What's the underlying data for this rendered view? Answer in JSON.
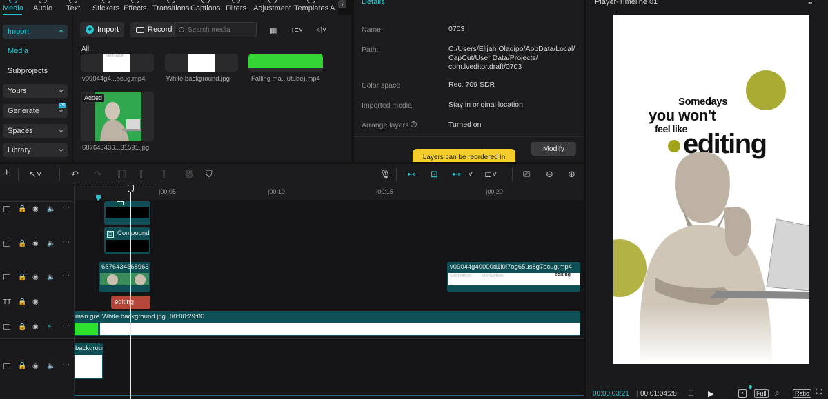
{
  "top_tabs": [
    {
      "label": "Media",
      "active": true
    },
    {
      "label": "Audio"
    },
    {
      "label": "Text"
    },
    {
      "label": "Stickers"
    },
    {
      "label": "Effects"
    },
    {
      "label": "Transitions"
    },
    {
      "label": "Captions"
    },
    {
      "label": "Filters"
    },
    {
      "label": "Adjustment"
    },
    {
      "label": "Templates"
    },
    {
      "label": "A"
    }
  ],
  "left_nav": {
    "import": "Import",
    "media": "Media",
    "subprojects": "Subprojects",
    "yours": "Yours",
    "generate": "Generate",
    "ai_badge": "AI",
    "spaces": "Spaces",
    "library": "Library"
  },
  "media_panel": {
    "import_label": "Import",
    "record_label": "Record",
    "search_placeholder": "Search media",
    "filter_all": "All",
    "thumb_text_top": "Motivation",
    "items": [
      {
        "label": "v09044g4...bcug.mp4"
      },
      {
        "label": "White background.jpg"
      },
      {
        "label": "Falling ma...utube).mp4"
      },
      {
        "label": "687643436...31591.jpg",
        "badge": "Added"
      }
    ]
  },
  "details": {
    "title": "Details",
    "rows": [
      {
        "label": "Name:",
        "value": "0703"
      },
      {
        "label": "Path:",
        "value": "C:/Users/Elijah Oladipo/AppData/Local/ CapCut/User Data/Projects/ com.lveditor.draft/0703"
      },
      {
        "label": "Color space",
        "value": "Rec. 709 SDR"
      },
      {
        "label": "Imported media:",
        "value": "Stay in original location"
      },
      {
        "label": "Arrange layers",
        "value": "Turned on"
      }
    ],
    "modify_label": "Modify",
    "layers_tip": "Layers can be reordered in"
  },
  "player": {
    "title": "Player-Timeline 01",
    "poster": {
      "line1": "Somedays",
      "line2": "you won't",
      "line3": "feel like",
      "line4": "editing"
    },
    "current_time": "00:00:03:21",
    "total_time": "00:01:04:28",
    "full_label": "Full",
    "ratio_label": "Ratio"
  },
  "timeline": {
    "ruler": [
      "|00:05",
      "|00:10",
      "|00:15",
      "|00:20"
    ],
    "clips": {
      "compound": "Compound",
      "image_name": "6876434368963",
      "video_right": "v09044g40000d1l0l7og65us8g7bcug.mp4",
      "video_right_text1": "Motivation",
      "video_right_text2": "Motivation",
      "video_right_text3": "editing",
      "text_clip": "editing",
      "green_clip": "man gre",
      "white_bg": "White background.jpg",
      "white_bg_duration": "00:00:29:06",
      "bottom_clip": "backgroun"
    }
  },
  "colors": {
    "accent": "#29c6d4",
    "clip_teal": "#0e4f55",
    "text_clip": "#b5473a",
    "green": "#2ee02e",
    "tip_yellow": "#f4cc2c",
    "olive_dot": "#a0a21c"
  }
}
